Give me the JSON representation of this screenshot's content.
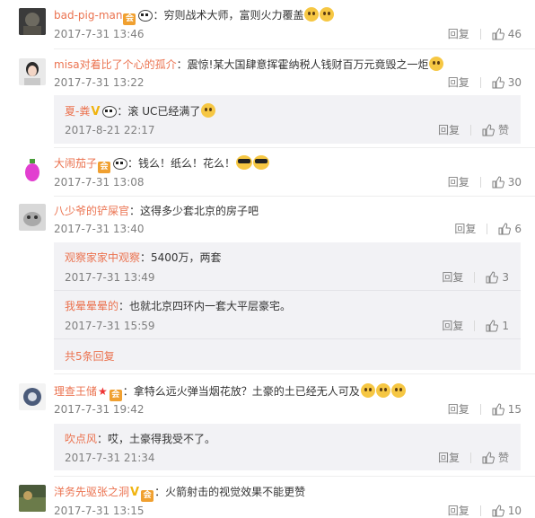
{
  "comments": [
    {
      "name": "bad-pig-man",
      "text": "：穷则战术大师，富则火力覆盖",
      "time": "2017-7-31 13:46",
      "reply": "回复",
      "likes": "46"
    },
    {
      "name": "misa对着比了个心的孤介",
      "text": "：震惊!某大国肆意挥霍纳税人钱财百万元竟毁之一炬",
      "time": "2017-7-31 13:22",
      "reply": "回复",
      "likes": "30",
      "sub": [
        {
          "name": "夏-粪",
          "text": "：滚 UC已经满了",
          "time": "2017-8-21 22:17",
          "reply": "回复",
          "likes": "赞"
        }
      ]
    },
    {
      "name": "大闹茄子",
      "text": "：钱么！纸么！花么！",
      "time": "2017-7-31 13:08",
      "reply": "回复",
      "likes": "30"
    },
    {
      "name": "八少爷的铲屎官",
      "text": "：这得多少套北京的房子吧",
      "time": "2017-7-31 13:40",
      "reply": "回复",
      "likes": "6",
      "sub": [
        {
          "name": "观察家家中观察",
          "text": "：5400万，两套",
          "time": "2017-7-31 13:49",
          "reply": "回复",
          "likes": "3"
        },
        {
          "name": "我晕晕晕的",
          "text": "：也就北京四环内一套大平层豪宅。",
          "time": "2017-7-31 15:59",
          "reply": "回复",
          "likes": "1"
        }
      ],
      "more": "共5条回复"
    },
    {
      "name": "理查王储",
      "text": "：拿特么远火弹当烟花放？土豪的土已经无人可及",
      "time": "2017-7-31 19:42",
      "reply": "回复",
      "likes": "15",
      "sub": [
        {
          "name": "吹点风",
          "text": "：哎，土豪得我受不了。",
          "time": "2017-7-31 21:34",
          "reply": "回复",
          "likes": "赞"
        }
      ]
    },
    {
      "name": "洋务先驱张之洞",
      "text": "：火箭射击的视觉效果不能更赞",
      "time": "2017-7-31 13:15",
      "reply": "回复",
      "likes": "10"
    }
  ],
  "colors": {
    "name": "#eb7350",
    "meta": "#808080",
    "subbg": "#f2f2f5"
  }
}
